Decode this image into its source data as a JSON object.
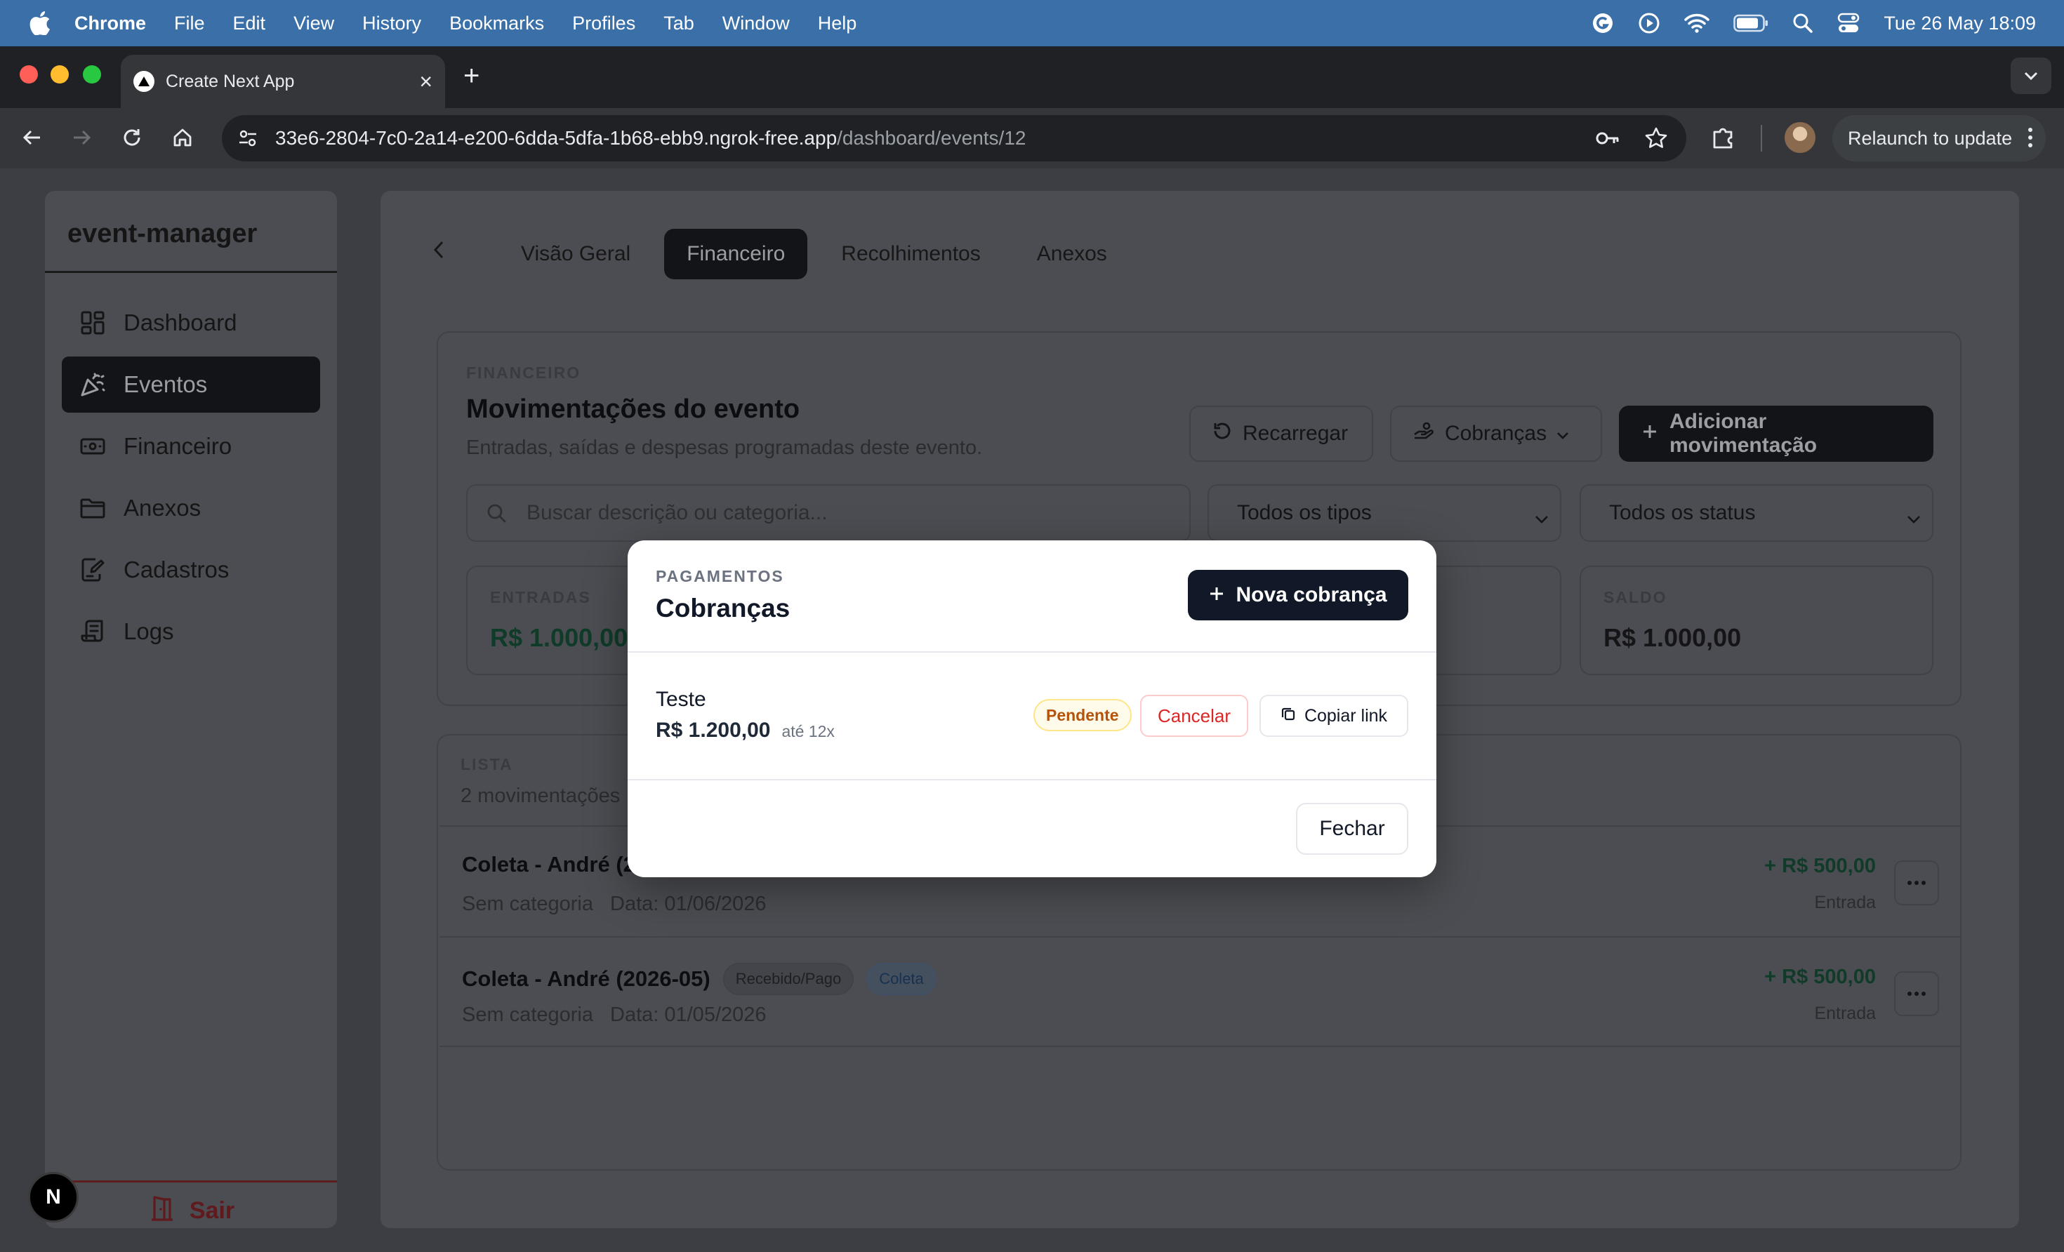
{
  "menubar": {
    "app": "Chrome",
    "items": [
      "File",
      "Edit",
      "View",
      "History",
      "Bookmarks",
      "Profiles",
      "Tab",
      "Window",
      "Help"
    ],
    "clock": "Tue 26 May  18:09"
  },
  "browser": {
    "tab_title": "Create Next App",
    "url_host": "33e6-2804-7c0-2a14-e200-6dda-5dfa-1b68-ebb9.ngrok-free.app",
    "url_path": "/dashboard/events/12",
    "relaunch_label": "Relaunch to update"
  },
  "sidebar": {
    "brand": "event-manager",
    "items": [
      {
        "label": "Dashboard",
        "icon": "dashboard-grid-icon"
      },
      {
        "label": "Eventos",
        "icon": "party-popper-icon"
      },
      {
        "label": "Financeiro",
        "icon": "banknote-icon"
      },
      {
        "label": "Anexos",
        "icon": "folder-icon"
      },
      {
        "label": "Cadastros",
        "icon": "edit-document-icon"
      },
      {
        "label": "Logs",
        "icon": "scroll-icon"
      }
    ],
    "active_index": 1,
    "logout_label": "Sair"
  },
  "next_badge": "N",
  "page_tabs": [
    "Visão Geral",
    "Financeiro",
    "Recolhimentos",
    "Anexos"
  ],
  "page_tabs_active": 1,
  "finance": {
    "eyebrow": "FINANCEIRO",
    "title": "Movimentações do evento",
    "subtitle": "Entradas, saídas e despesas programadas deste evento.",
    "reload_label": "Recarregar",
    "charges_label": "Cobranças",
    "add_label": "Adicionar movimentação",
    "search_placeholder": "Buscar descrição ou categoria...",
    "type_filter": "Todos os tipos",
    "status_filter": "Todos os status",
    "stats": {
      "entradas_label": "ENTRADAS",
      "entradas_value": "R$ 1.000,00",
      "saldo_label": "SALDO",
      "saldo_value": "R$ 1.000,00"
    }
  },
  "list": {
    "eyebrow": "LISTA",
    "count": "2 movimentações",
    "rows": [
      {
        "title": "Coleta - André (2",
        "status": "",
        "tag": "",
        "category": "Sem categoria",
        "date": "Data: 01/06/2026",
        "amount": "+ R$ 500,00",
        "kind": "Entrada"
      },
      {
        "title": "Coleta - André (2026-05)",
        "status": "Recebido/Pago",
        "tag": "Coleta",
        "category": "Sem categoria",
        "date": "Data: 01/05/2026",
        "amount": "+ R$ 500,00",
        "kind": "Entrada"
      }
    ]
  },
  "modal": {
    "eyebrow": "PAGAMENTOS",
    "title": "Cobranças",
    "new_label": "Nova cobrança",
    "charge": {
      "name": "Teste",
      "amount": "R$ 1.200,00",
      "installments": "até 12x",
      "status": "Pendente",
      "cancel_label": "Cancelar",
      "copy_label": "Copiar link"
    },
    "close_label": "Fechar"
  },
  "colors": {
    "modal_primary": "#111827",
    "pending_text": "#b45309",
    "cancel_text": "#dc2626",
    "income_text": "#1f7a52"
  }
}
